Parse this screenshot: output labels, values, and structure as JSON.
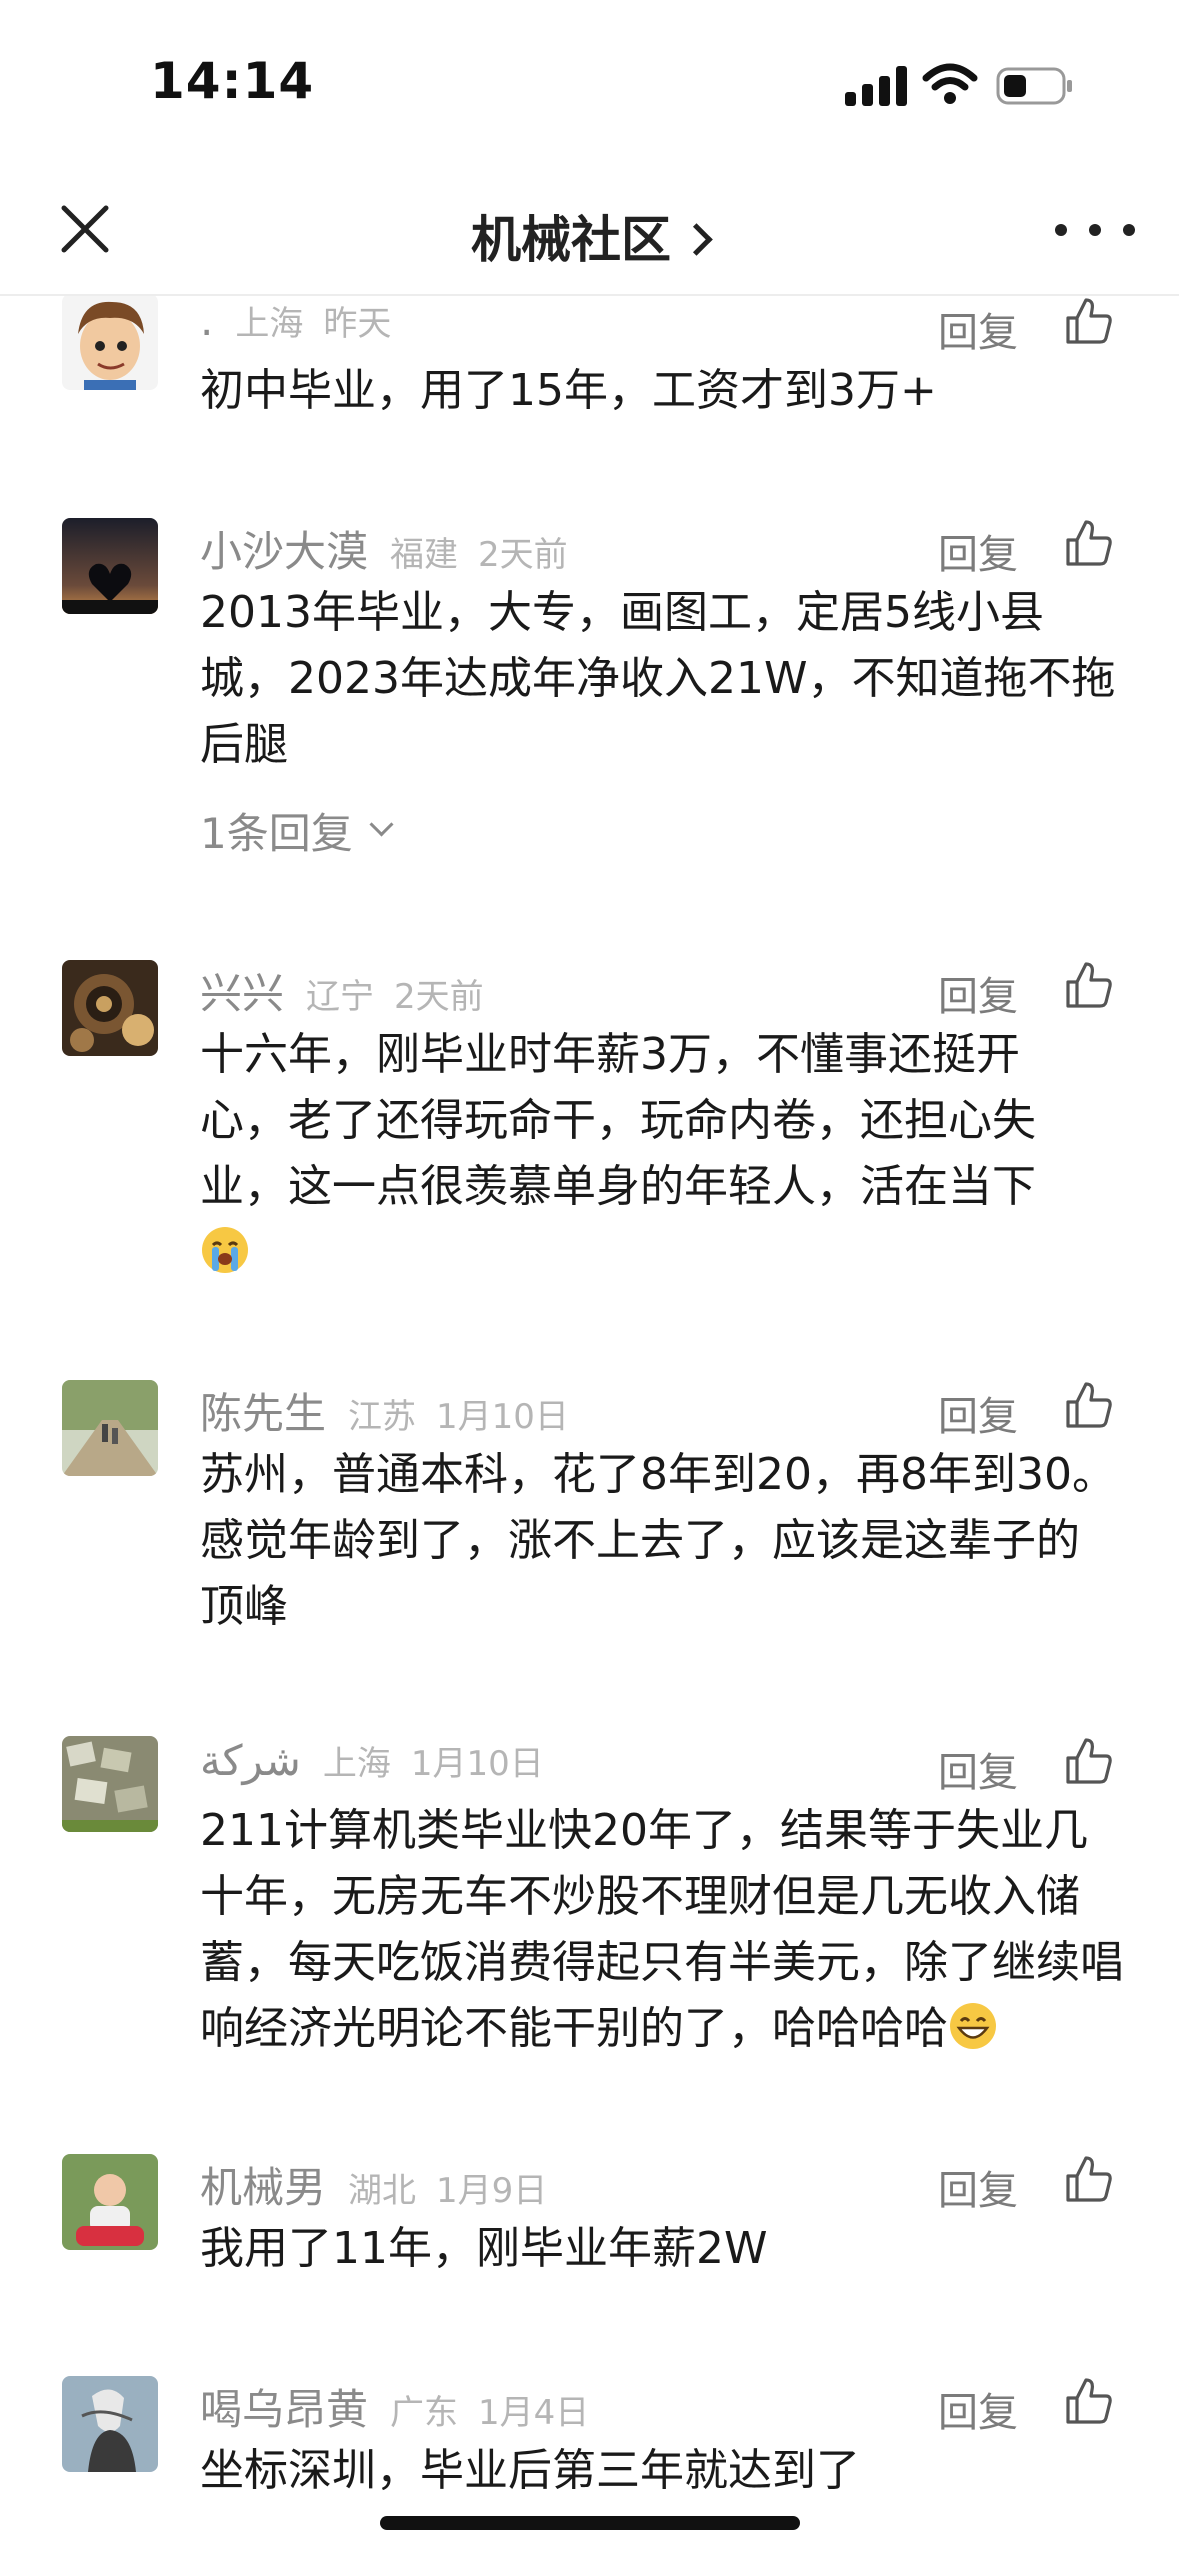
{
  "status_bar": {
    "time": "14:14"
  },
  "nav": {
    "title": "机械社区"
  },
  "comments": [
    {
      "username": ".",
      "location": "上海",
      "date": "昨天",
      "text": "初中毕业，用了15年，工资才到3万+",
      "reply_label": "回复"
    },
    {
      "username": "小沙大漠",
      "location": "福建",
      "date": "2天前",
      "text": "2013年毕业，大专，画图工，定居5线小县城，2023年达成年净收入21W，不知道拖不拖后腿",
      "reply_label": "回复",
      "replies_label": "1条回复"
    },
    {
      "username": "兴兴",
      "location": "辽宁",
      "date": "2天前",
      "text": "十六年，刚毕业时年薪3万，不懂事还挺开心，老了还得玩命干，玩命内卷，还担心失业，这一点很羡慕单身的年轻人，活在当下",
      "reply_label": "回复",
      "emoji": "crying-face-icon"
    },
    {
      "username": "陈先生",
      "location": "江苏",
      "date": "1月10日",
      "text": "苏州，普通本科，花了8年到20，再8年到30。感觉年龄到了，涨不上去了，应该是这辈子的顶峰",
      "reply_label": "回复"
    },
    {
      "username": "شركة",
      "location": "上海",
      "date": "1月10日",
      "text": "211计算机类毕业快20年了，结果等于失业几十年，无房无车不炒股不理财但是几无收入储蓄，每天吃饭消费得起只有半美元，除了继续唱响经济光明论不能干别的了，哈哈哈哈",
      "reply_label": "回复",
      "emoji": "grinning-face-icon"
    },
    {
      "username": "机械男",
      "location": "湖北",
      "date": "1月9日",
      "text": "我用了11年，刚毕业年薪2W",
      "reply_label": "回复"
    },
    {
      "username": "喝乌昂黄",
      "location": "广东",
      "date": "1月4日",
      "text": "坐标深圳，毕业后第三年就达到了",
      "reply_label": "回复"
    }
  ]
}
